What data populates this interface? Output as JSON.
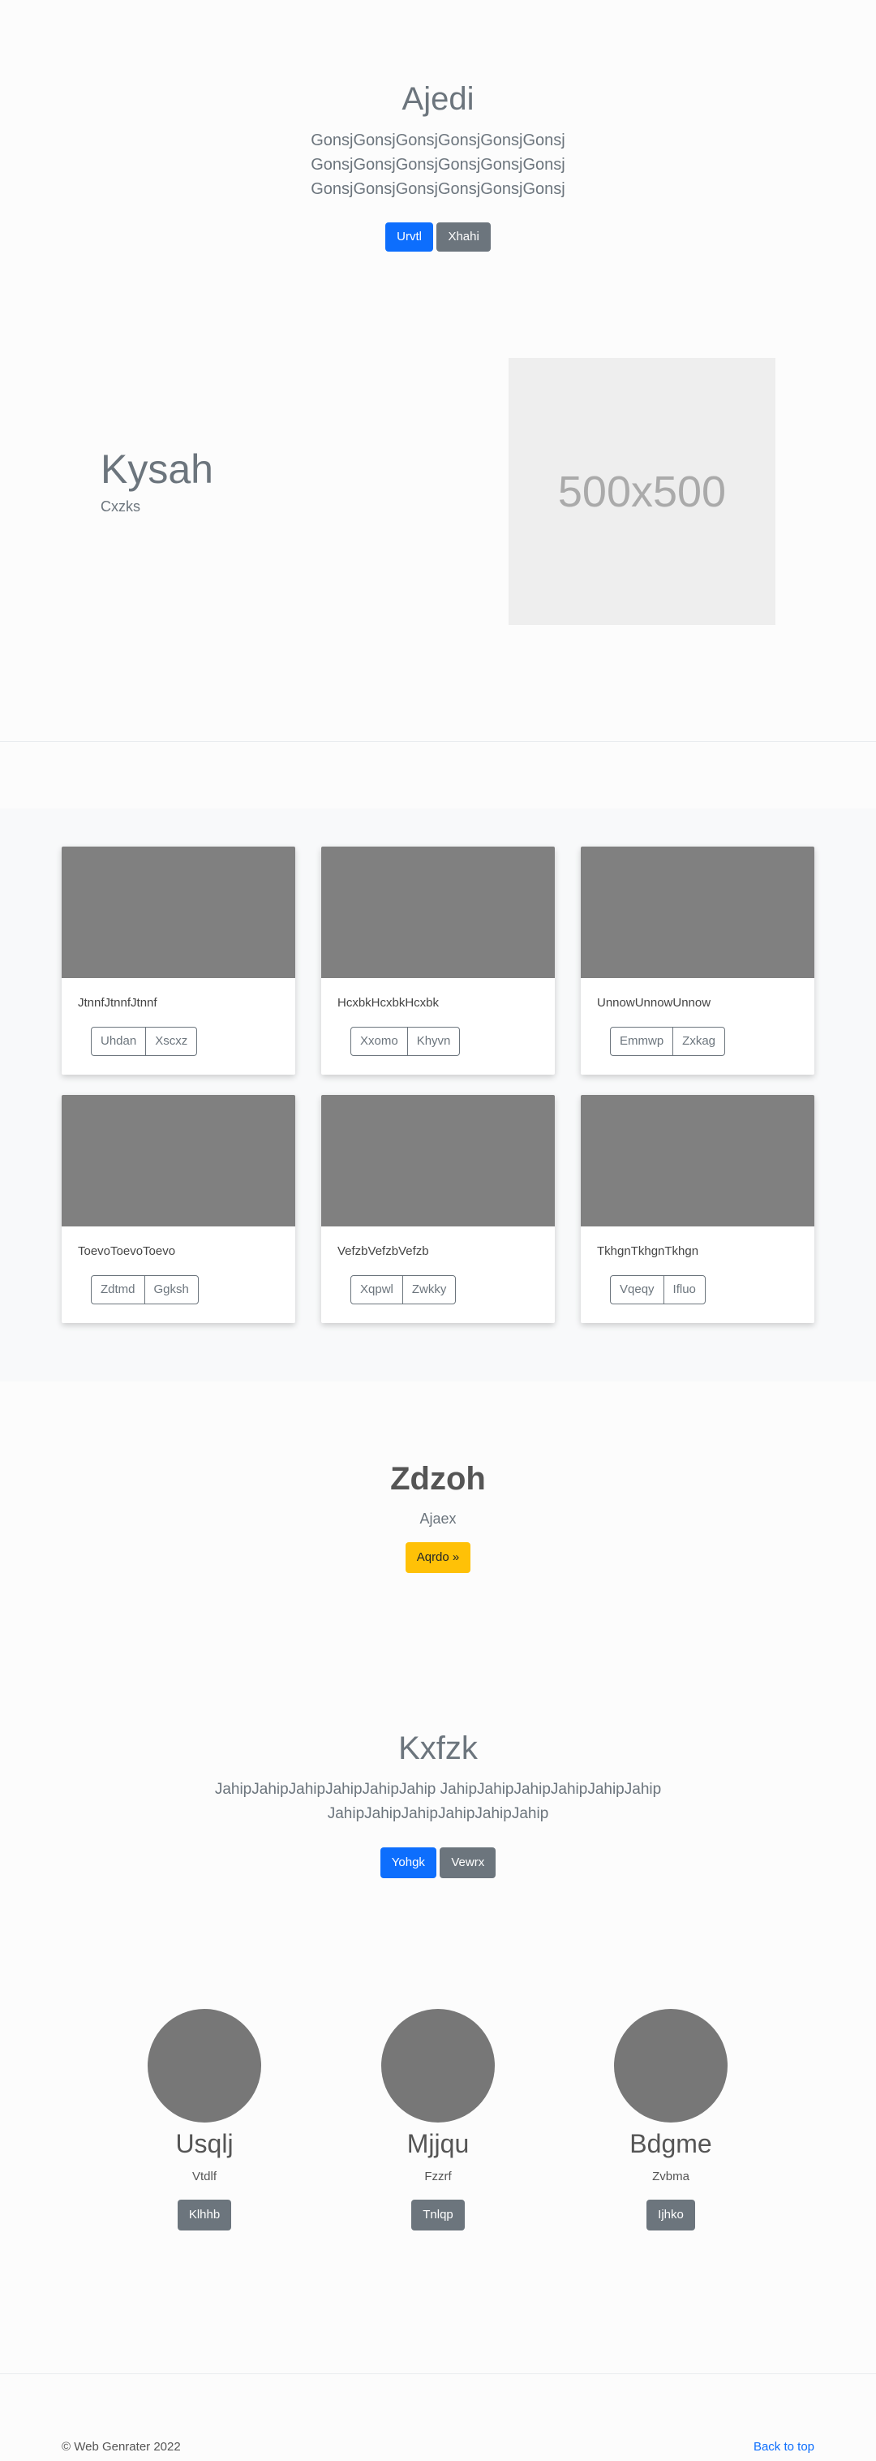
{
  "hero": {
    "title": "Ajedi",
    "lead": "GonsjGonsjGonsjGonsjGonsjGonsj GonsjGonsjGonsjGonsjGonsjGonsj GonsjGonsjGonsjGonsjGonsjGonsj",
    "primary_button": "Urvtl",
    "secondary_button": "Xhahi"
  },
  "feature": {
    "title": "Kysah",
    "subtitle": "Cxzks",
    "image_label": "500x500"
  },
  "album": {
    "cards": [
      {
        "text": "JtnnfJtnnfJtnnf",
        "buttons": [
          "Uhdan",
          "Xscxz"
        ]
      },
      {
        "text": "HcxbkHcxbkHcxbk",
        "buttons": [
          "Xxomo",
          "Khyvn"
        ]
      },
      {
        "text": "UnnowUnnowUnnow",
        "buttons": [
          "Emmwp",
          "Zxkag"
        ]
      },
      {
        "text": "ToevoToevoToevo",
        "buttons": [
          "Zdtmd",
          "Ggksh"
        ]
      },
      {
        "text": "VefzbVefzbVefzb",
        "buttons": [
          "Xqpwl",
          "Zwkky"
        ]
      },
      {
        "text": "TkhgnTkhgnTkhgn",
        "buttons": [
          "Vqeqy",
          "Ifluo"
        ]
      }
    ]
  },
  "cta": {
    "title": "Zdzoh",
    "subtitle": "Ajaex",
    "button": "Aqrdo »"
  },
  "hero2": {
    "title": "Kxfzk",
    "lead": "JahipJahipJahipJahipJahipJahip JahipJahipJahipJahipJahipJahip JahipJahipJahipJahipJahipJahip",
    "primary_button": "Yohgk",
    "secondary_button": "Vewrx"
  },
  "team": [
    {
      "name": "Usqlj",
      "role": "Vtdlf",
      "button": "Klhhb"
    },
    {
      "name": "Mjjqu",
      "role": "Fzzrf",
      "button": "Tnlqp"
    },
    {
      "name": "Bdgme",
      "role": "Zvbma",
      "button": "Ijhko"
    }
  ],
  "footer": {
    "copyright": "© Web Genrater 2022",
    "back_to_top": "Back to top"
  }
}
